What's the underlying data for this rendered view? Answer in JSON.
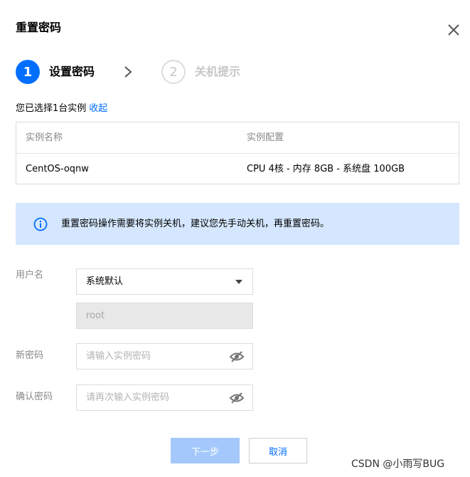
{
  "dialog": {
    "title": "重置密码"
  },
  "steps": [
    {
      "number": "1",
      "label": "设置密码",
      "state": "active"
    },
    {
      "number": "2",
      "label": "关机提示",
      "state": "inactive"
    }
  ],
  "selection": {
    "text": "您已选择1台实例",
    "collapse_label": "收起"
  },
  "instance_table": {
    "columns": [
      "实例名称",
      "实例配置"
    ],
    "rows": [
      [
        "CentOS-oqnw",
        "CPU 4核 - 内存 8GB - 系统盘 100GB"
      ]
    ]
  },
  "notice": {
    "text": "重置密码操作需要将实例关机，建议您先手动关机，再重置密码。",
    "icon": "info-icon"
  },
  "form": {
    "username": {
      "label": "用户名",
      "selected": "系统默认",
      "value": "root"
    },
    "new_password": {
      "label": "新密码",
      "placeholder": "请输入实例密码"
    },
    "confirm_password": {
      "label": "确认密码",
      "placeholder": "请再次输入实例密码"
    }
  },
  "buttons": {
    "next": "下一步",
    "cancel": "取消"
  },
  "watermark": "CSDN @小雨写BUG",
  "colors": {
    "accent": "#006eff",
    "notice_bg": "#d5e7fe",
    "next_disabled_bg": "#a4c8fb"
  }
}
